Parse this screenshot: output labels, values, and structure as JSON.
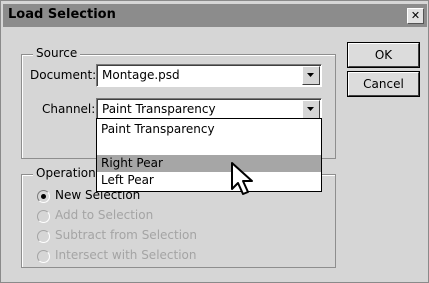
{
  "dialog": {
    "title": "Load Selection",
    "close_glyph": "✕"
  },
  "source": {
    "legend": "Source",
    "document_label": "Document:",
    "document_value": "Montage.psd",
    "channel_label": "Channel:",
    "channel_value": "Paint Transparency"
  },
  "dropdown": {
    "items": [
      "Paint Transparency",
      "Right Pear",
      "Left Pear"
    ],
    "highlighted": "Right Pear"
  },
  "operation": {
    "legend": "Operation",
    "options": [
      "New Selection",
      "Add to Selection",
      "Subtract from Selection",
      "Intersect with Selection"
    ],
    "selected": "New Selection"
  },
  "buttons": {
    "ok": "OK",
    "cancel": "Cancel"
  },
  "icons": {
    "close": "close-icon",
    "combo_arrow": "chevron-down-icon",
    "cursor": "mouse-pointer-icon"
  }
}
